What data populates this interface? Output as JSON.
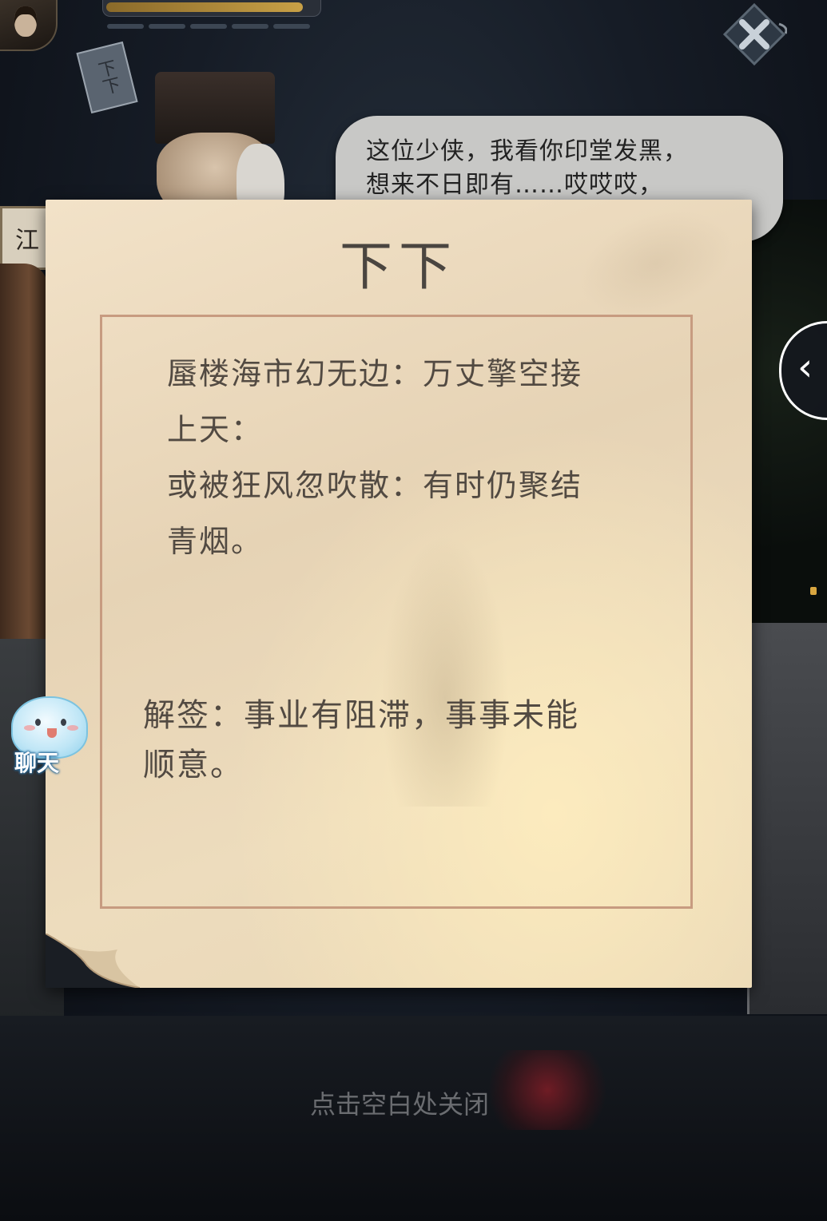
{
  "scene": {
    "scroll_tag": "下下",
    "sign_board": "江",
    "npc_dialog": {
      "line1": "这位少侠，我看你印堂发黑，",
      "line2": "想来不日即有……哎哎哎，"
    }
  },
  "hud": {
    "hp_fraction": 0.94,
    "energy_segments": 5
  },
  "fortune_modal": {
    "grade": "下下",
    "poem": [
      "蜃楼海市幻无边：万丈擎空接",
      "上天：",
      "或被狂风忽吹散：有时仍聚结",
      "青烟。"
    ],
    "interpretation": [
      "解签：事业有阻滞，事事未能",
      "顺意。"
    ]
  },
  "chat": {
    "label": "聊天"
  },
  "close_hint": "点击空白处关闭",
  "side_arrow": "‹",
  "colors": {
    "paper": "#eddcbd",
    "frame_border": "#c79b80",
    "text": "#524a42",
    "title": "#4a4540",
    "bubble": "#c8c8c6"
  }
}
